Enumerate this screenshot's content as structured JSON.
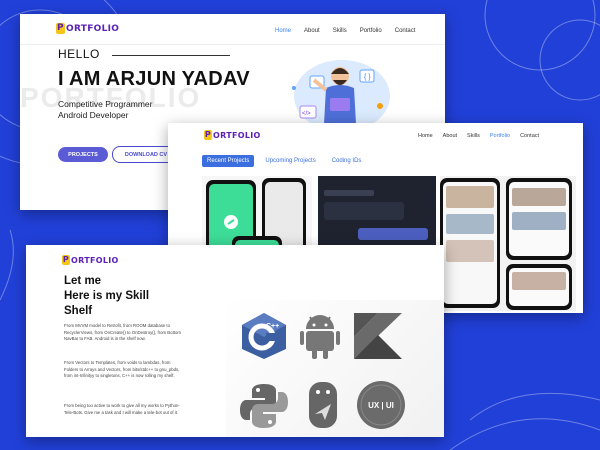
{
  "colors": {
    "background": "#2140d8",
    "accent": "#3b6fe0",
    "logo": "#5b21b6",
    "primary_button": "#5b5bd6"
  },
  "home": {
    "logo_text": "ORTFOLIO",
    "logo_mark": "P",
    "nav": [
      "Home",
      "About",
      "Skills",
      "Portfolio",
      "Contact"
    ],
    "active_nav": "Home",
    "hello": "HELLO",
    "name": "I AM ARJUN YADAV",
    "role_line1": "Competitive Programmer",
    "role_line2": "Android Developer",
    "watermark": "PORTFOLIO",
    "projects_button": "PROJECTS",
    "download_button": "DOWNLOAD CV"
  },
  "portfolio": {
    "logo_text": "ORTFOLIO",
    "logo_mark": "P",
    "nav": [
      "Home",
      "About",
      "Skills",
      "Portfolio",
      "Contact"
    ],
    "active_nav": "Portfolio",
    "tabs": [
      "Recent Projects",
      "Upcoming Projects",
      "Coding IDs"
    ],
    "active_tab": "Recent Projects"
  },
  "skills": {
    "logo_text": "ORTFOLIO",
    "logo_mark": "P",
    "title_line1": "Let me",
    "title_line2": "Here is my Skill",
    "title_line3": "Shelf",
    "paragraphs": [
      "From MVVM model to Retrofit, from ROOM database to RecyclerViews, from OnCreate() to OnDestroy(), from Bottom NavBar to FAB. Android is in the shelf now.",
      "From Vectors to Templates, from voids to lambdas, from Folders to Arrays and Vectors, from bits/stdc++ to gnu_pbds, from int-Infinityy to singletons, C++ is now rolling my shelf.",
      "From being too active to work to give all my works to Python-Tele-Bots. Give me a task and I will make a tele-bot out of it."
    ]
  },
  "skill_icons": [
    {
      "name": "cpp-icon",
      "label": "C++"
    },
    {
      "name": "android-icon",
      "label": ""
    },
    {
      "name": "kotlin-icon",
      "label": ""
    },
    {
      "name": "python-icon",
      "label": ""
    },
    {
      "name": "telegram-bot-icon",
      "label": ""
    },
    {
      "name": "ux-ui-icon",
      "label": "UX | UI"
    }
  ]
}
